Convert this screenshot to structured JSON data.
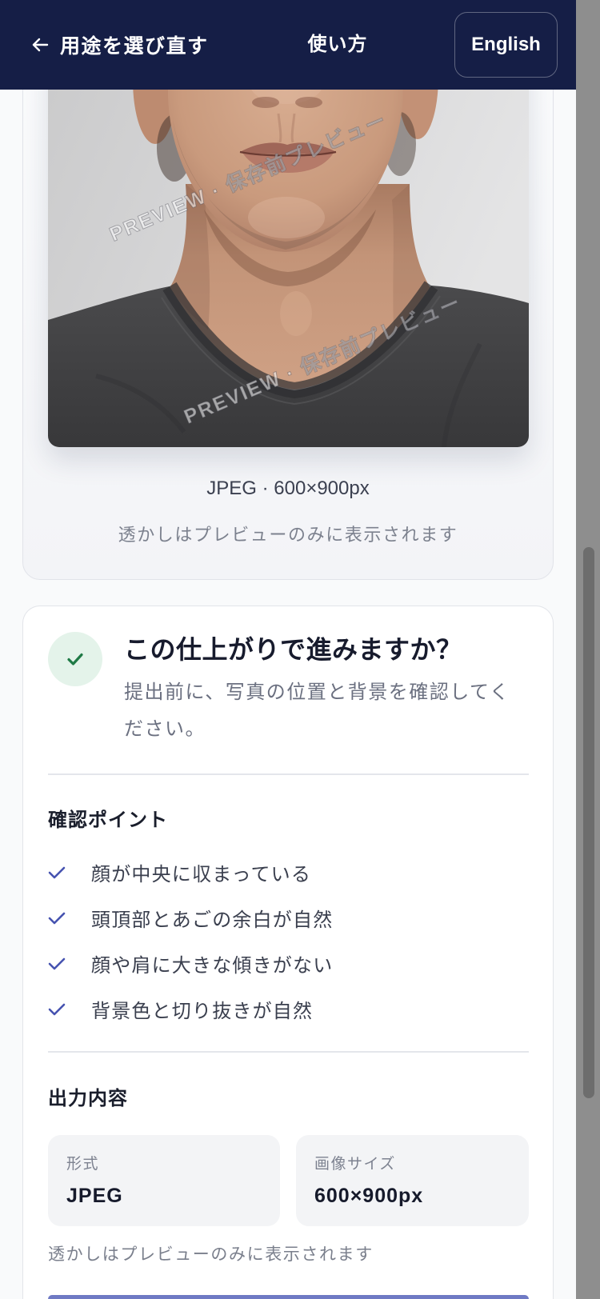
{
  "header": {
    "back_label": "用途を選び直す",
    "title": "使い方",
    "language_button": "English"
  },
  "preview": {
    "watermark_text": "PREVIEW · 保存前プレビュー",
    "file_info": "JPEG · 600×900px",
    "watermark_note": "透かしはプレビューのみに表示されます"
  },
  "confirm": {
    "title": "この仕上がりで進みますか？",
    "subtitle": "提出前に、写真の位置と背景を確認してください。",
    "checkpoints_heading": "確認ポイント",
    "checkpoints": [
      "顔が中央に収まっている",
      "頭頂部とあごの余白が自然",
      "顔や肩に大きな傾きがない",
      "背景色と切り抜きが自然"
    ],
    "output_heading": "出力内容",
    "output": [
      {
        "label": "形式",
        "value": "JPEG"
      },
      {
        "label": "画像サイズ",
        "value": "600×900px"
      }
    ],
    "watermark_note": "透かしはプレビューのみに表示されます"
  },
  "colors": {
    "header_background": "#151e46",
    "accent": "#4653b0",
    "success": "#1f7a46",
    "success_background": "#e4f3ea"
  },
  "icons": {
    "back": "arrow-left-icon",
    "confirm_badge": "check-icon",
    "checkpoint": "check-icon"
  }
}
